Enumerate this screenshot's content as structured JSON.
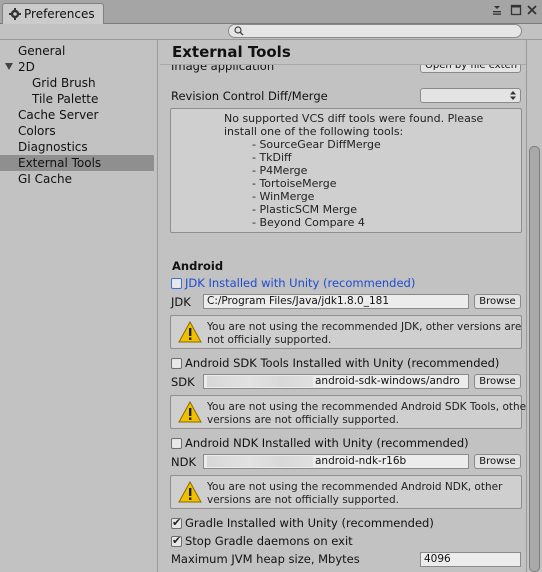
{
  "window": {
    "tab_title": "Preferences"
  },
  "search": {
    "placeholder": ""
  },
  "sidebar": {
    "items": [
      {
        "label": "General"
      },
      {
        "label": "2D"
      },
      {
        "label": "Grid Brush"
      },
      {
        "label": "Tile Palette"
      },
      {
        "label": "Cache Server"
      },
      {
        "label": "Colors"
      },
      {
        "label": "Diagnostics"
      },
      {
        "label": "External Tools"
      },
      {
        "label": "GI Cache"
      }
    ]
  },
  "content": {
    "title": "External Tools",
    "image_app": {
      "label": "Image application",
      "value": "Open by file exten"
    },
    "revision": {
      "label": "Revision Control Diff/Merge",
      "value": ""
    },
    "vcs_help": "No supported VCS diff tools were found. Please\ninstall one of the following tools:\n        - SourceGear DiffMerge\n        - TkDiff\n        - P4Merge\n        - TortoiseMerge\n        - WinMerge\n        - PlasticSCM Merge\n        - Beyond Compare 4",
    "android": {
      "title": "Android",
      "jdk_checkbox": "JDK Installed with Unity (recommended)",
      "jdk_label": "JDK",
      "jdk_path": "C:/Program Files/Java/jdk1.8.0_181",
      "jdk_warning": "You are not using the recommended JDK, other versions are\nnot officially supported.",
      "sdk_checkbox": "Android SDK Tools Installed with Unity (recommended)",
      "sdk_label": "SDK",
      "sdk_path": "android-sdk-windows/andro",
      "sdk_warning": "You are not using the recommended Android SDK Tools, other\nversions are not officially supported.",
      "ndk_checkbox": "Android NDK Installed with Unity (recommended)",
      "ndk_label": "NDK",
      "ndk_path": "android-ndk-r16b",
      "ndk_warning": "You are not using the recommended Android NDK, other\nversions are not officially supported.",
      "browse_label": "Browse",
      "gradle_checkbox": "Gradle Installed with Unity (recommended)",
      "stop_gradle_checkbox": "Stop Gradle daemons on exit",
      "jvm_label": "Maximum JVM heap size, Mbytes",
      "jvm_value": "4096"
    }
  }
}
